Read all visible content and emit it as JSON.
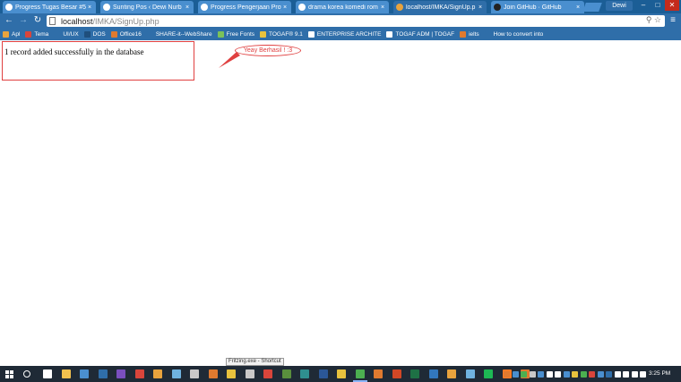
{
  "browser": {
    "tabs": [
      {
        "label": "Progress Tugas Besar #5",
        "icon": "wordpress-icon",
        "color": "#4a8fcf",
        "active": false
      },
      {
        "label": "Sunting Pos ‹ Dewi Nurb",
        "icon": "wordpress-icon",
        "color": "#4a8fcf",
        "active": false
      },
      {
        "label": "Progress Pengerjaan Proy",
        "icon": "wordpress-icon",
        "color": "#4a8fcf",
        "active": false
      },
      {
        "label": "drama korea komedi rom",
        "icon": "google-icon",
        "color": "#4a8fcf",
        "active": false
      },
      {
        "label": "localhost/IMKA/SignUp.p",
        "icon": "page-icon",
        "color": "#4a8fcf",
        "active": true
      },
      {
        "label": "Join GitHub · GitHub",
        "icon": "github-icon",
        "color": "#4a8fcf",
        "active": false
      }
    ],
    "profile_name": "Dewi",
    "window_controls": {
      "minimize": "–",
      "maximize": "□",
      "close": "✕"
    },
    "url_host": "localhost",
    "url_path": "/IMKA/SignUp.php",
    "bookmarks": [
      {
        "label": "Apl",
        "icon": "apps-icon",
        "color": "#e8a33d"
      },
      {
        "label": "Tema",
        "icon": "tema-icon",
        "color": "#d9453b"
      },
      {
        "label": "UI/UX",
        "icon": "uiux-icon",
        "color": "#2f6ea9"
      },
      {
        "label": "DOS",
        "icon": "dos-icon",
        "color": "#1f4f7d"
      },
      {
        "label": "Office16",
        "icon": "office-icon",
        "color": "#e07a2f"
      },
      {
        "label": "SHARE-it--WebShare",
        "icon": "share-icon",
        "color": "#2f6ea9"
      },
      {
        "label": "Free Fonts",
        "icon": "font-icon",
        "color": "#7bc25a"
      },
      {
        "label": "TOGAF® 9.1",
        "icon": "togaf-icon",
        "color": "#e8c23d"
      },
      {
        "label": "ENTERPRISE ARCHITE",
        "icon": "wordpress-icon",
        "color": "#ffffff"
      },
      {
        "label": "TOGAF ADM | TOGAF",
        "icon": "wordpress-icon",
        "color": "#ffffff"
      },
      {
        "label": "ielts",
        "icon": "ielts-icon",
        "color": "#e07a2f"
      },
      {
        "label": "How to convert into",
        "icon": "doc-icon",
        "color": "#2f6ea9"
      }
    ]
  },
  "page": {
    "message": "1 record added successfully in the database"
  },
  "annotation": {
    "text": "Yeay Berhasil ! :3",
    "color": "#e04040"
  },
  "tooltip": {
    "text": "Fritzing.exe - Shortcut"
  },
  "taskbar": {
    "time": "3:25 PM",
    "icons": [
      {
        "name": "task-view-icon",
        "color": "#ffffff"
      },
      {
        "name": "file-explorer-icon",
        "color": "#f2c14e"
      },
      {
        "name": "store-icon",
        "color": "#4a8fcf"
      },
      {
        "name": "outlook-icon",
        "color": "#2f6ea9"
      },
      {
        "name": "visual-studio-icon",
        "color": "#7a4fbf"
      },
      {
        "name": "app-red-icon",
        "color": "#d9453b"
      },
      {
        "name": "app-pen-icon",
        "color": "#e8a33d"
      },
      {
        "name": "notepad-icon",
        "color": "#6fb3e0"
      },
      {
        "name": "app-gear-icon",
        "color": "#c9c9c9"
      },
      {
        "name": "app-circle-icon",
        "color": "#e07a2f"
      },
      {
        "name": "app-edit-icon",
        "color": "#e8c23d"
      },
      {
        "name": "calculator-icon",
        "color": "#c9c9c9"
      },
      {
        "name": "foxit-icon",
        "color": "#d9453b"
      },
      {
        "name": "app-grid-icon",
        "color": "#5a8f3d"
      },
      {
        "name": "publisher-icon",
        "color": "#2f8f8f"
      },
      {
        "name": "word-icon",
        "color": "#2b5797"
      },
      {
        "name": "app-colorful-icon",
        "color": "#e8c23d"
      },
      {
        "name": "chrome-icon",
        "color": "#4caf50"
      },
      {
        "name": "sublime-icon",
        "color": "#e07a2f"
      },
      {
        "name": "powerpoint-icon",
        "color": "#d24726"
      },
      {
        "name": "excel-icon",
        "color": "#1e7145"
      },
      {
        "name": "edge-icon",
        "color": "#3277bc"
      },
      {
        "name": "app-orange-icon",
        "color": "#e8a33d"
      },
      {
        "name": "paint-icon",
        "color": "#6fb3e0"
      },
      {
        "name": "spotify-icon",
        "color": "#1db954"
      },
      {
        "name": "xampp-icon",
        "color": "#fb7a24"
      },
      {
        "name": "app-box-icon",
        "color": "#e07a2f"
      }
    ],
    "tray_icons": [
      {
        "name": "tray-app-icon",
        "color": "#e07a2f"
      },
      {
        "name": "tray-s-icon",
        "color": "#4a8fcf"
      },
      {
        "name": "tray-drive-icon",
        "color": "#4caf50"
      },
      {
        "name": "tray-cloud-icon",
        "color": "#c9c9c9"
      },
      {
        "name": "tray-ie-icon",
        "color": "#4a8fcf"
      },
      {
        "name": "tray-shield-icon",
        "color": "#ffffff"
      },
      {
        "name": "bluetooth-icon",
        "color": "#ffffff"
      },
      {
        "name": "tray-chat-icon",
        "color": "#4a8fcf"
      },
      {
        "name": "tray-yellow-icon",
        "color": "#e8c23d"
      },
      {
        "name": "tray-green-icon",
        "color": "#4caf50"
      },
      {
        "name": "tray-red-icon",
        "color": "#d9453b"
      },
      {
        "name": "tray-s2-icon",
        "color": "#4a8fcf"
      },
      {
        "name": "tray-blue-icon",
        "color": "#2f6ea9"
      },
      {
        "name": "tray-bracket-icon",
        "color": "#ffffff"
      },
      {
        "name": "network-icon",
        "color": "#ffffff"
      },
      {
        "name": "volume-icon",
        "color": "#ffffff"
      },
      {
        "name": "battery-icon",
        "color": "#ffffff"
      }
    ]
  }
}
